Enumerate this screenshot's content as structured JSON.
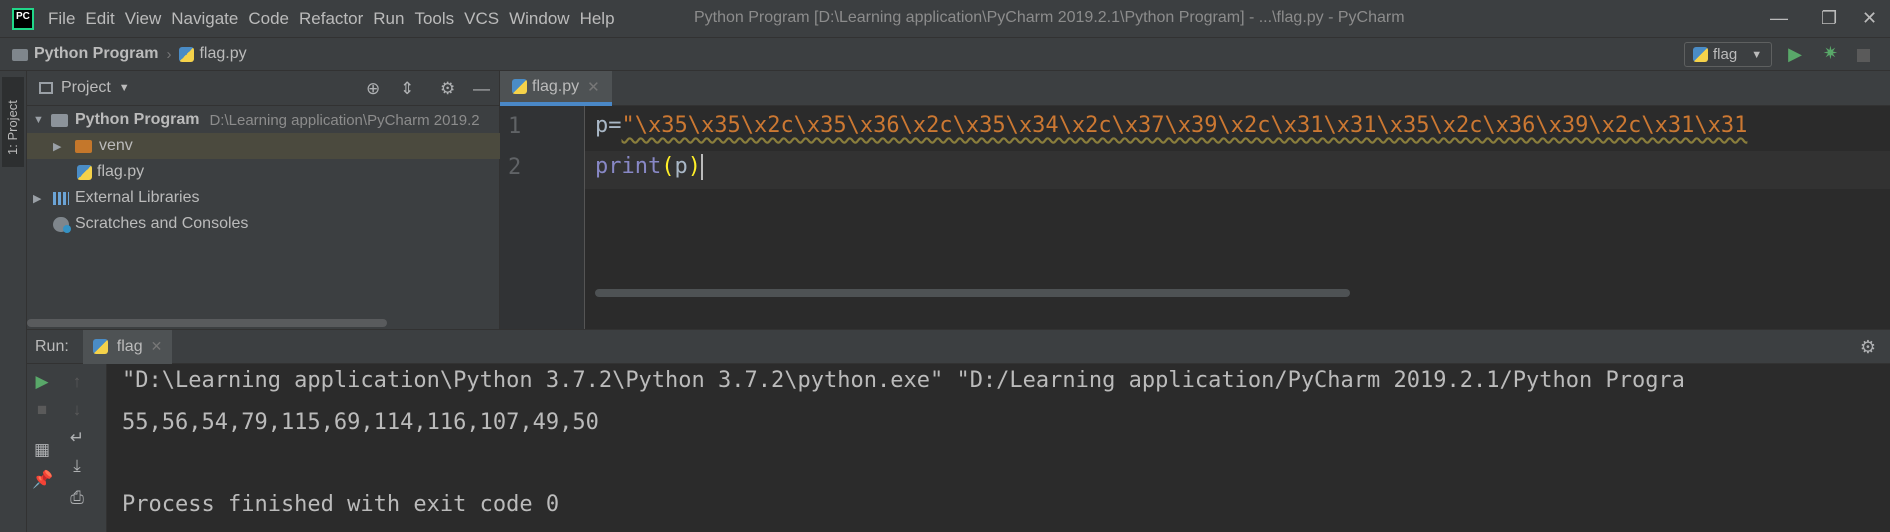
{
  "menu": [
    "File",
    "Edit",
    "View",
    "Navigate",
    "Code",
    "Refactor",
    "Run",
    "Tools",
    "VCS",
    "Window",
    "Help"
  ],
  "window_title": "Python Program [D:\\Learning application\\PyCharm 2019.2.1\\Python Program] - ...\\flag.py - PyCharm",
  "navbar": {
    "project": "Python Program",
    "file": "flag.py",
    "run_config": "flag"
  },
  "left_stripe": {
    "label": "1: Project"
  },
  "project_panel": {
    "title": "Project",
    "tree": [
      {
        "label": "Python Program",
        "path": "D:\\Learning application\\PyCharm 2019.2"
      },
      {
        "label": "venv"
      },
      {
        "label": "flag.py"
      },
      {
        "label": "External Libraries"
      },
      {
        "label": "Scratches and Consoles"
      }
    ]
  },
  "editor": {
    "tab": "flag.py",
    "line_numbers": [
      "1",
      "2"
    ],
    "line1": {
      "var": "p=",
      "string": "\"\\x35\\x35\\x2c\\x35\\x36\\x2c\\x35\\x34\\x2c\\x37\\x39\\x2c\\x31\\x31\\x35\\x2c\\x36\\x39\\x2c\\x31\\x31"
    },
    "line2": {
      "func": "print",
      "open": "(",
      "arg": "p",
      "close": ")"
    }
  },
  "run_panel": {
    "label": "Run:",
    "tab": "flag",
    "console": [
      "\"D:\\Learning application\\Python 3.7.2\\Python 3.7.2\\python.exe\" \"D:/Learning application/PyCharm 2019.2.1/Python Progra",
      "55,56,54,79,115,69,114,116,107,49,50",
      "",
      "Process finished with exit code 0"
    ]
  },
  "colors": {
    "background": "#2b2b2b",
    "panel": "#3c3f41",
    "string": "#cc7832",
    "builtin": "#8888c6",
    "run_green": "#59a869",
    "tab_accent": "#4a88c7"
  }
}
